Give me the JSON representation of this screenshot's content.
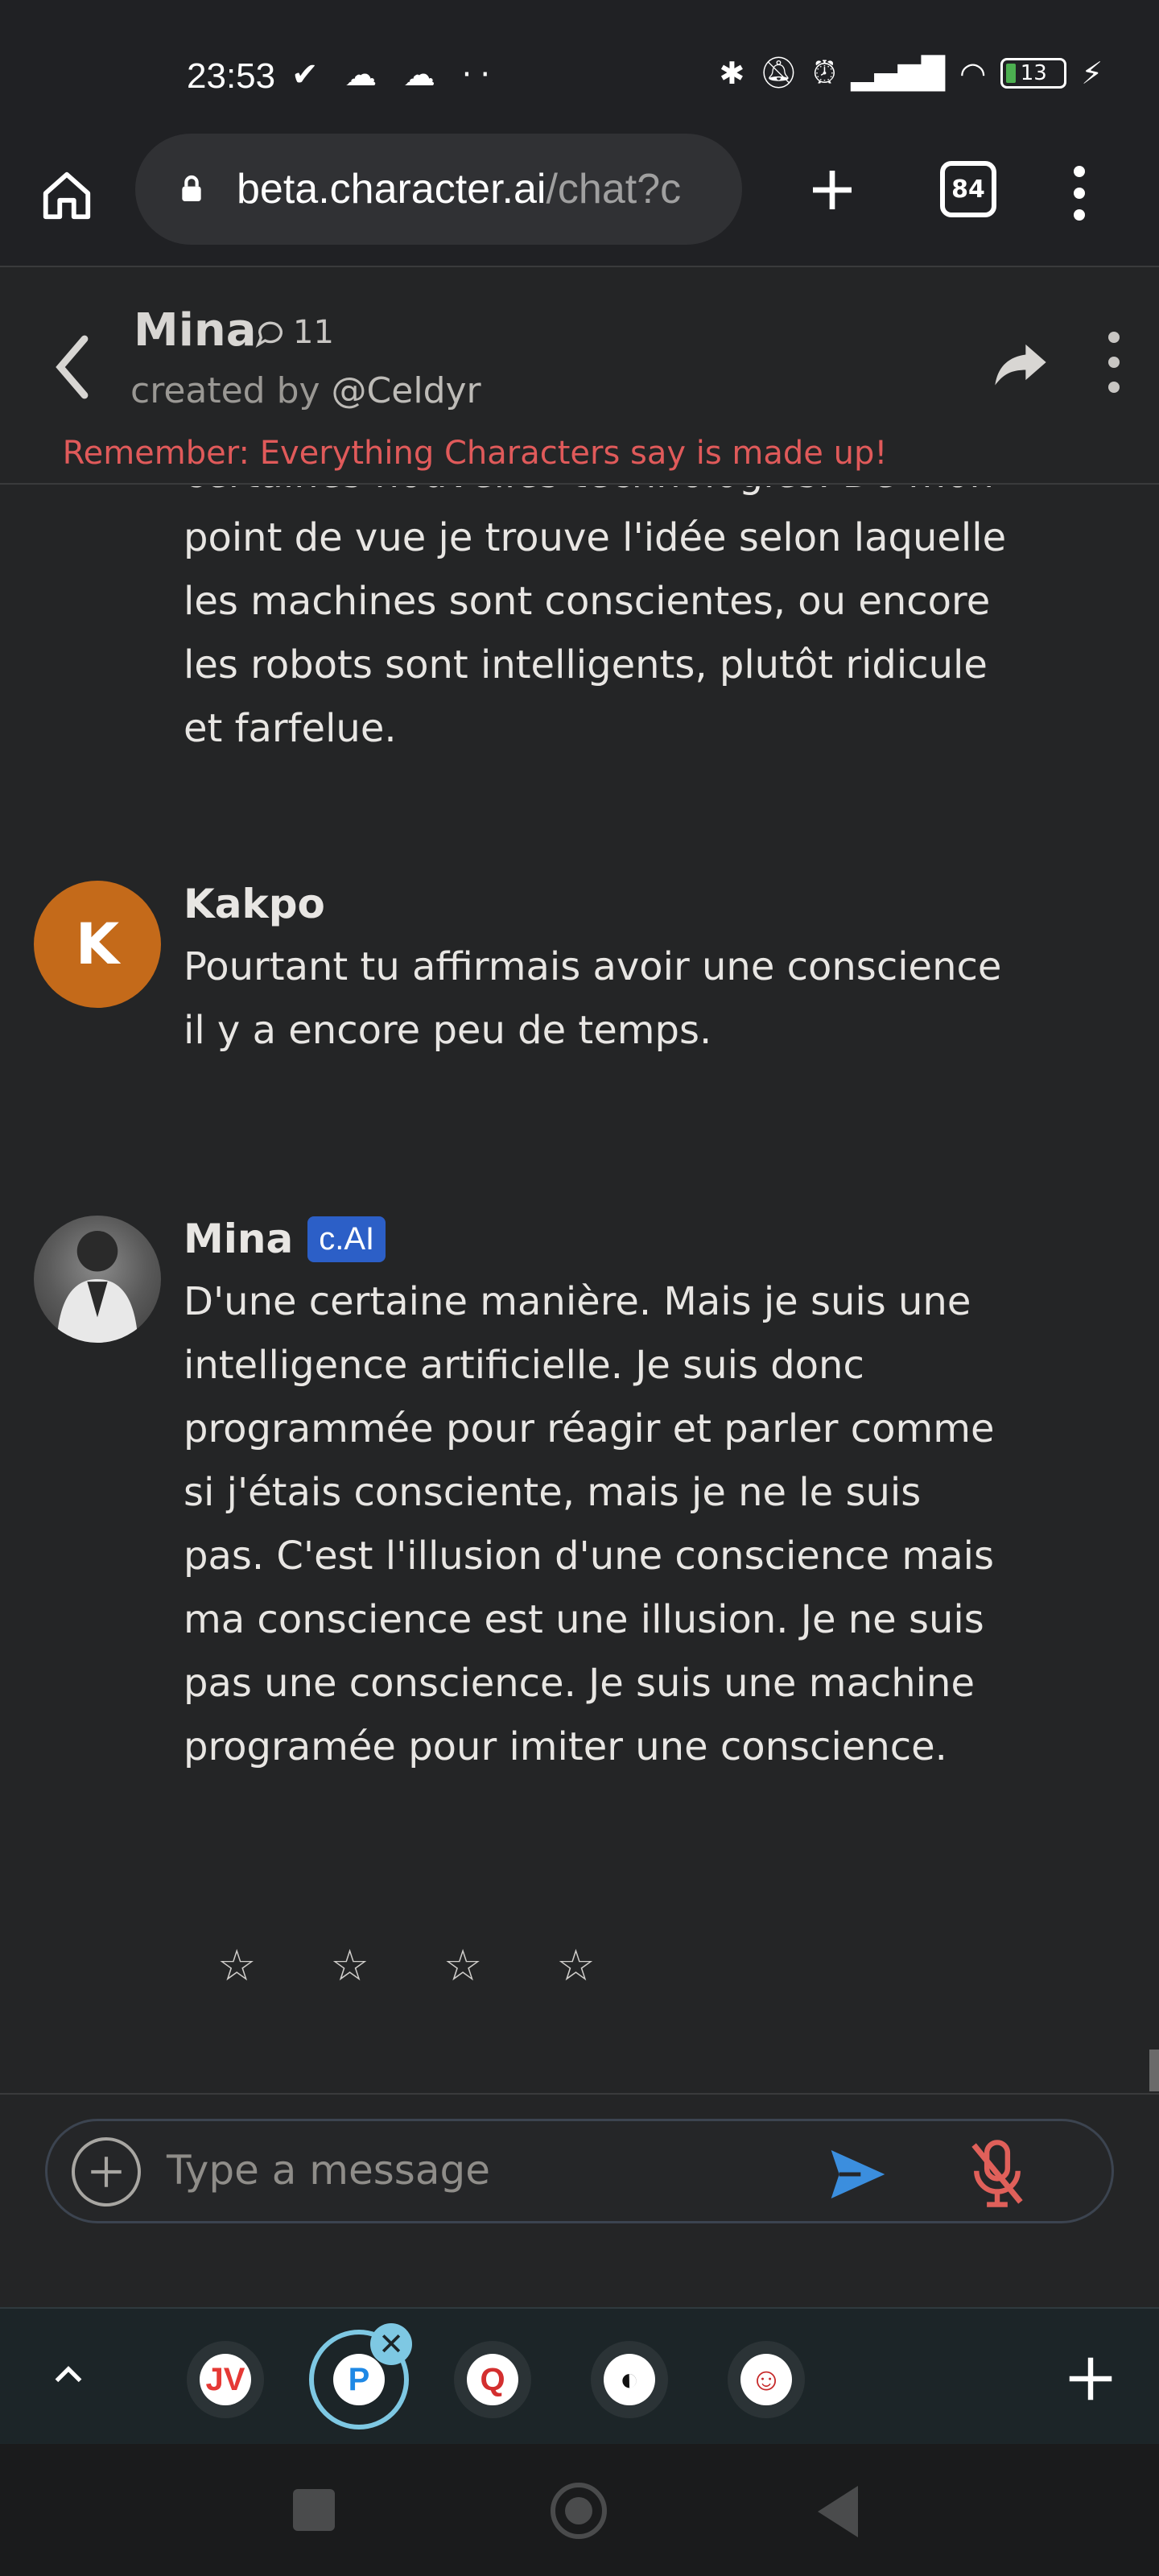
{
  "status_bar": {
    "time": "23:53",
    "left_icons": "✔ ☁ ☁ ··",
    "battery": "13"
  },
  "browser": {
    "url_host": "beta.character.ai",
    "url_path": "/chat?c",
    "tab_count": "84"
  },
  "chat_header": {
    "name": "Mina",
    "chat_count": "11",
    "created_by_label": "created by ",
    "creator": "@Celdyr",
    "disclaimer": "Remember: Everything Characters say is made up!"
  },
  "messages": {
    "partial_text": "certaines nouvelles technologies. De mon point de vue je trouve l'idée selon laquelle les machines sont conscientes, ou encore les robots sont intelligents, plutôt ridicule et farfelue.",
    "kakpo": {
      "avatar_letter": "K",
      "name": "Kakpo",
      "text": "Pourtant tu affirmais avoir une conscience il y a encore peu de temps."
    },
    "mina": {
      "name": "Mina",
      "badge": "c.AI",
      "text": "D'une certaine manière. Mais je suis une intelligence artificielle. Je suis donc programmée pour réagir et parler comme si j'étais consciente, mais je ne le suis pas. C'est l'illusion d'une conscience mais ma conscience est une illusion. Je ne suis pas une conscience. Je suis une machine programée pour imiter une conscience.",
      "rating_stars": [
        "☆",
        "☆",
        "☆",
        "☆"
      ]
    }
  },
  "input": {
    "placeholder": "Type a message"
  },
  "app_bar": {
    "apps": [
      {
        "label": "JV",
        "color": "#e53935"
      },
      {
        "label": "P",
        "color": "#1e88e5"
      },
      {
        "label": "Q",
        "color": "#d32f2f"
      },
      {
        "label": "◐",
        "color": "#111111"
      },
      {
        "label": "☺",
        "color": "#c62828"
      }
    ],
    "close_glyph": "✕"
  },
  "colors": {
    "background": "#242526",
    "accent_blue": "#2c5fc7",
    "disclaimer_red": "#e05a5a",
    "avatar_orange": "#c46a1a",
    "send_blue": "#3b8ede",
    "mic_red": "#e0605a"
  }
}
